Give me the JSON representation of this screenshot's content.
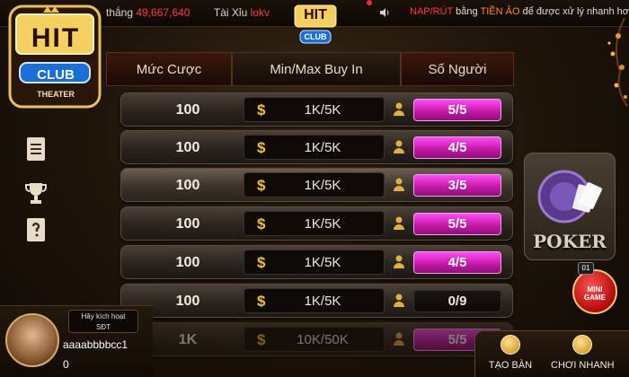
{
  "ticker": {
    "prefix": "thắng",
    "amount": "49,667,640",
    "game": "Tài Xỉu",
    "player": "lokv"
  },
  "notice": {
    "part1": "NẠP/RÚT",
    "part2": "bằng",
    "part3": "TIỀN ẢO",
    "part4": "để được xử lý nhanh hơn"
  },
  "logo": {
    "brand": "HIT",
    "club": "CLUB",
    "sub": "THEATER"
  },
  "headers": {
    "bet": "Mức Cược",
    "buyin": "Min/Max Buy In",
    "players": "Số Người"
  },
  "rows": [
    {
      "bet": "100",
      "buyin": "1K/5K",
      "players": "5/5",
      "fill": 1.0
    },
    {
      "bet": "100",
      "buyin": "1K/5K",
      "players": "4/5",
      "fill": 0.8
    },
    {
      "bet": "100",
      "buyin": "1K/5K",
      "players": "3/5",
      "fill": 0.6
    },
    {
      "bet": "100",
      "buyin": "1K/5K",
      "players": "5/5",
      "fill": 1.0
    },
    {
      "bet": "100",
      "buyin": "1K/5K",
      "players": "4/5",
      "fill": 0.8
    },
    {
      "bet": "100",
      "buyin": "1K/5K",
      "players": "0/9",
      "fill": 0.0
    },
    {
      "bet": "1K",
      "buyin": "10K/50K",
      "players": "5/5",
      "fill": 1.0
    }
  ],
  "poker": {
    "label": "POKER"
  },
  "minigame": {
    "badge": "01",
    "label1": "MINI",
    "label2": "GAME"
  },
  "user": {
    "activate_line1": "Hãy kích hoạt",
    "activate_line2": "SĐT",
    "name": "aaaabbbbcc1",
    "balance": "0"
  },
  "buttons": {
    "create": "TẠO BÀN",
    "quick": "CHƠI NHANH"
  },
  "colors": {
    "accent": "#e040d0",
    "gold": "#f2c230",
    "red": "#ff3b3b"
  }
}
